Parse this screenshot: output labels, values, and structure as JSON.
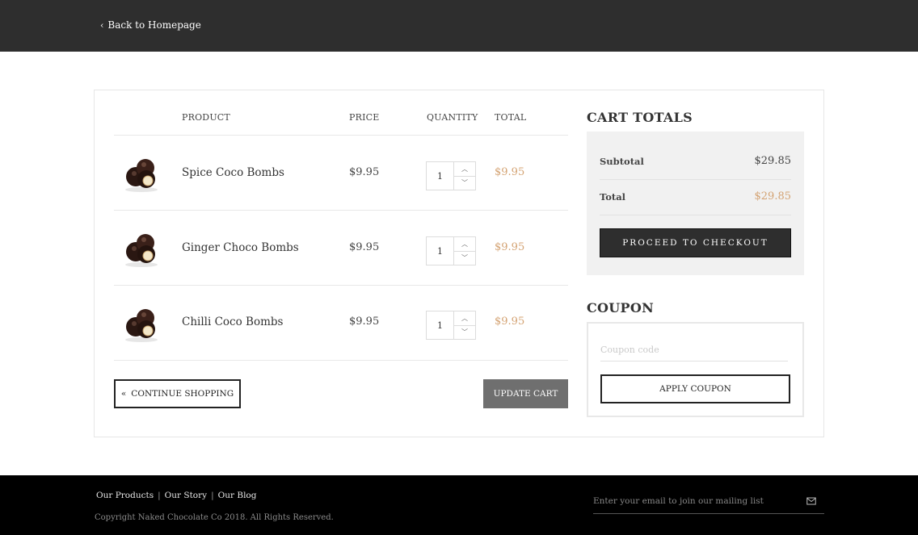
{
  "header": {
    "back_label": "Back to Homepage",
    "back_icon": "chevron-left-icon"
  },
  "cart": {
    "columns": {
      "product": "PRODUCT",
      "price": "PRICE",
      "quantity": "QUANTITY",
      "total": "TOTAL"
    },
    "items": [
      {
        "name": "Spice Coco Bombs",
        "price": "$9.95",
        "quantity": "1",
        "total": "$9.95"
      },
      {
        "name": "Ginger Choco Bombs",
        "price": "$9.95",
        "quantity": "1",
        "total": "$9.95"
      },
      {
        "name": "Chilli Coco Bombs",
        "price": "$9.95",
        "quantity": "1",
        "total": "$9.95"
      }
    ],
    "continue_label": "CONTINUE SHOPPING",
    "update_label": "UPDATE CART"
  },
  "totals": {
    "title": "CART TOTALS",
    "subtotal_label": "Subtotal",
    "subtotal_value": "$29.85",
    "total_label": "Total",
    "total_value": "$29.85",
    "checkout_label": "PROCEED TO CHECKOUT"
  },
  "coupon": {
    "title": "COUPON",
    "placeholder": "Coupon code",
    "apply_label": "APPLY COUPON"
  },
  "footer": {
    "links": [
      "Our Products",
      "Our Story",
      "Our Blog"
    ],
    "copyright": "Copyright Naked Chocolate Co 2018. All Rights Reserved.",
    "newsletter_placeholder": "Enter your email to join our mailing list"
  },
  "colors": {
    "accent": "#d4a373",
    "header_bg": "#2e2e2e",
    "footer_bg": "#000000"
  }
}
